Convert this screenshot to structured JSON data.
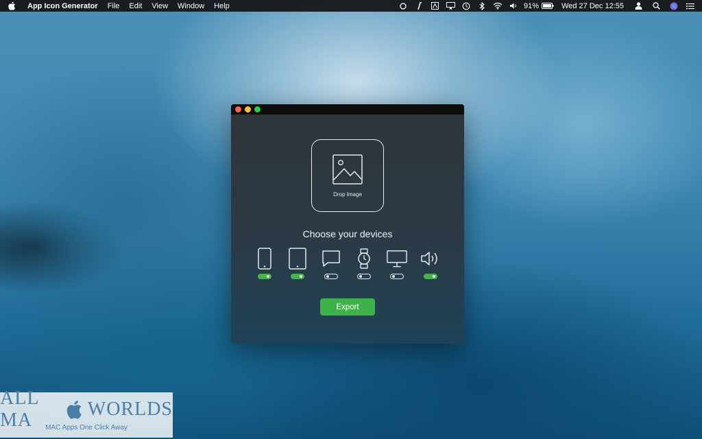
{
  "menubar": {
    "apple_icon": "apple-icon",
    "app_name": "App Icon Generator",
    "items": [
      "File",
      "Edit",
      "View",
      "Window",
      "Help"
    ],
    "tray_icons": [
      "circle-icon",
      "pen-icon",
      "text-box-icon",
      "airplay-icon",
      "time-machine-icon",
      "bluetooth-icon",
      "wifi-icon",
      "volume-icon"
    ],
    "battery_percent": "91%",
    "clock": "Wed 27 Dec  12:55",
    "user_icon": "user-icon",
    "search_icon": "search-icon",
    "siri_icon": "siri-icon",
    "notifications_icon": "list-icon"
  },
  "window": {
    "drop_label": "Drop Image",
    "choose_title": "Choose your devices",
    "devices": [
      {
        "name": "iphone",
        "icon": "phone-icon",
        "enabled": true
      },
      {
        "name": "ipad",
        "icon": "tablet-icon",
        "enabled": true
      },
      {
        "name": "imessage",
        "icon": "message-icon",
        "enabled": false
      },
      {
        "name": "watch",
        "icon": "watch-icon",
        "enabled": false
      },
      {
        "name": "mac",
        "icon": "monitor-icon",
        "enabled": false
      },
      {
        "name": "speaker",
        "icon": "speaker-icon",
        "enabled": true
      }
    ],
    "export_label": "Export"
  },
  "watermark": {
    "line1_a": "ALL MA",
    "line1_b": "WORLDS",
    "line2": "MAC Apps One Click Away"
  },
  "colors": {
    "accent_green": "#3fb14a",
    "close": "#fc605c",
    "minimize": "#fdbc40",
    "maximize": "#34c84a"
  }
}
